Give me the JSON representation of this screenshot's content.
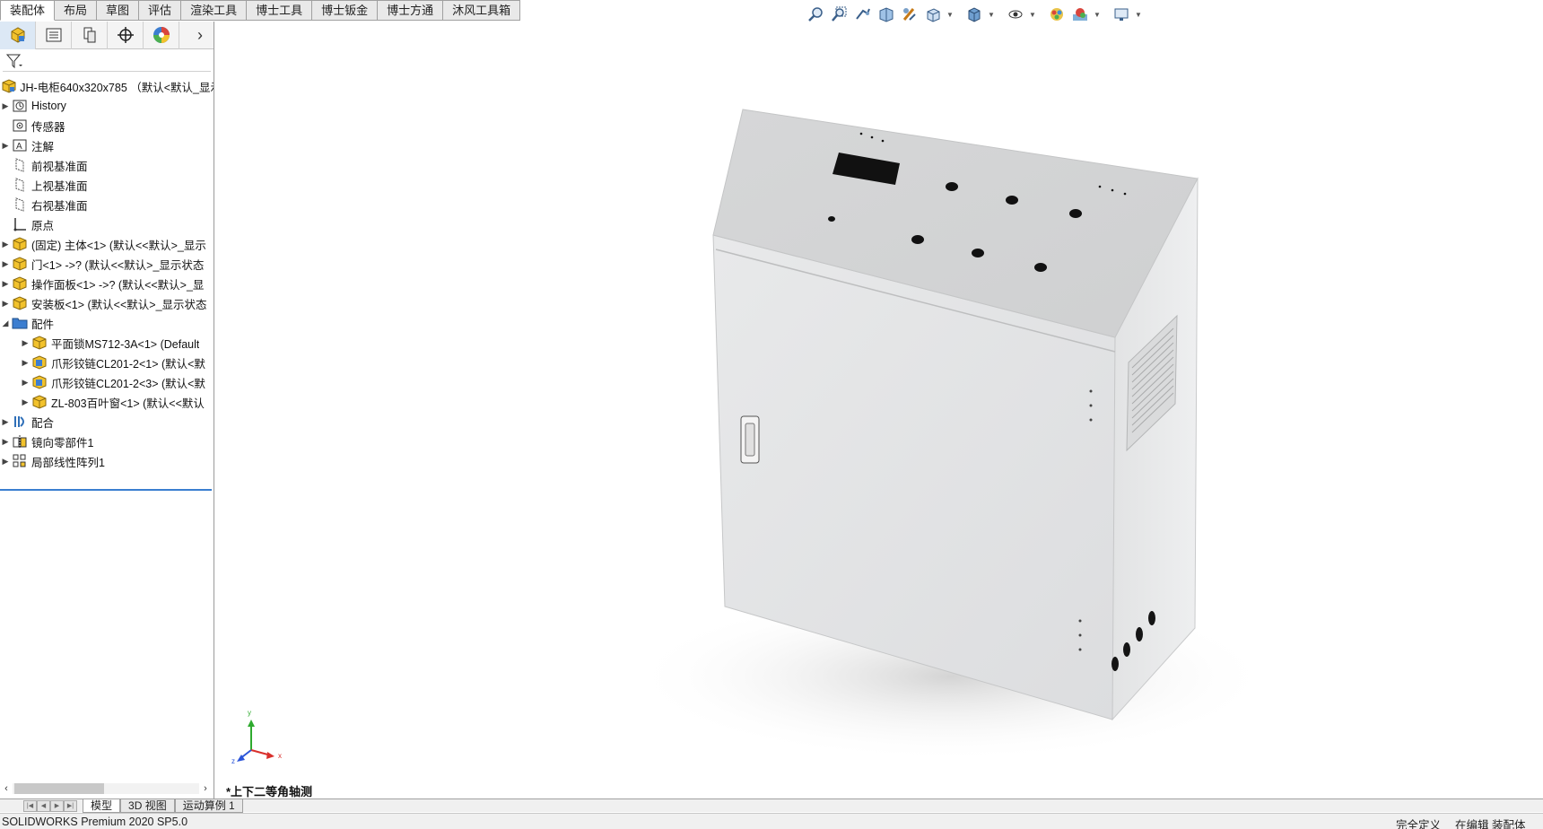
{
  "command_tabs": [
    "装配体",
    "布局",
    "草图",
    "评估",
    "渲染工具",
    "博士工具",
    "博士钣金",
    "博士方通",
    "沐风工具箱"
  ],
  "active_tab_index": 0,
  "feature_tree": {
    "root": "JH-电柜640x320x785 （默认<默认_显示",
    "items": [
      {
        "label": "History"
      },
      {
        "label": "传感器"
      },
      {
        "label": "注解"
      },
      {
        "label": "前视基准面"
      },
      {
        "label": "上视基准面"
      },
      {
        "label": "右视基准面"
      },
      {
        "label": "原点"
      },
      {
        "label": "(固定) 主体<1> (默认<<默认>_显示"
      },
      {
        "label": "门<1> ->? (默认<<默认>_显示状态"
      },
      {
        "label": "操作面板<1> ->? (默认<<默认>_显"
      },
      {
        "label": "安装板<1> (默认<<默认>_显示状态"
      },
      {
        "label": "配件"
      },
      {
        "label": "平面锁MS712-3A<1> (Default"
      },
      {
        "label": "爪形铰链CL201-2<1> (默认<默"
      },
      {
        "label": "爪形铰链CL201-2<3> (默认<默"
      },
      {
        "label": "ZL-803百叶窗<1> (默认<<默认"
      },
      {
        "label": "配合"
      },
      {
        "label": "镜向零部件1"
      },
      {
        "label": "局部线性阵列1"
      }
    ]
  },
  "view_name": "*上下二等角轴测",
  "triad": {
    "x": "x",
    "y": "y",
    "z": "z"
  },
  "bottom_tabs": [
    "模型",
    "3D 视图",
    "运动算例 1"
  ],
  "status": {
    "app": "SOLIDWORKS Premium 2020 SP5.0",
    "definition": "完全定义",
    "mode": "在编辑 装配体"
  },
  "colors": {
    "accent": "#3a7ed0",
    "part_yellow": "#f2c22c",
    "cabinet": "#e4e5e6"
  }
}
